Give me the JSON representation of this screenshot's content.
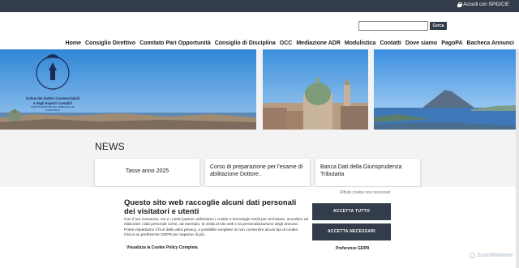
{
  "topbar": {
    "login_label": "Accedi con SPID/CIE"
  },
  "search": {
    "placeholder": "",
    "button_label": "Cerca"
  },
  "nav": {
    "items": [
      "Home",
      "Consiglio Direttivo",
      "Comitato Pari Opportunità",
      "Consiglio di Disciplina",
      "OCC",
      "Mediazione ADR",
      "Modulistica",
      "Contatti",
      "Dove siamo",
      "PagoPA",
      "Bacheca Annunci"
    ]
  },
  "logo": {
    "line1": "Ordine dei Dottori Commercialisti",
    "line2": "e degli Esperti Contabili",
    "line3": "CIRCOSCRIZIONE DEL TRIBUNALE DI CATANZARO"
  },
  "news": {
    "title": "NEWS",
    "cards": [
      "Tasse anno 2025",
      "Corso di preparazione per l'esame di abilitazione Dottore..",
      "Banca Dati della Giurisprudenza Tributaria"
    ]
  },
  "cookie": {
    "title": "Questo sito web raccoglie alcuni dati personali dei visitatori e utenti",
    "text": "Con il tuo consenso, noi e i nostri partner utilizziamo i cookie e tecnologie simili per archiviare, accedere ed elaborare i dati personali come, ad esempio, la visita al sito web o la personalizzazione degli annunci. Potrai rispettiamo il fruir della altra privacy, e possibile scegliere di non consentire alcuni tipi di cookie. Clicca su preferenze GDPR per saperne di più.",
    "policy_link": "Visualizza la Cookie Policy Completa",
    "reject_link": "Rifiuta cookie non necessari",
    "accept_button": "ACCETTA TUTTO",
    "necessary_button": "ACCETTA NECESSARI",
    "gdpr_link": "Preferenze GDPR"
  },
  "watermark": {
    "label": "ScanMalware"
  },
  "colors": {
    "topbar": "#323c4a",
    "button": "#323c4a",
    "background": "#f3f3f3",
    "logo_blue": "#1b2b55"
  }
}
